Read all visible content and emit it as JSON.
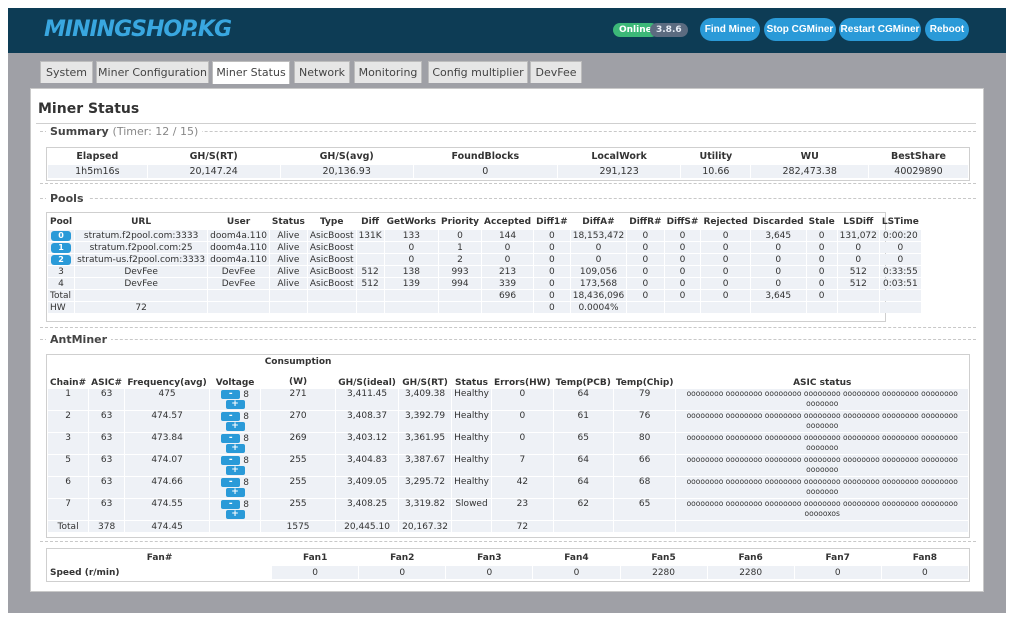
{
  "header": {
    "logo": "MININGSHOP.KG",
    "status": "Online",
    "version": "3.8.6",
    "buttons": [
      "Find Miner",
      "Stop CGMiner",
      "Restart CGMiner",
      "Reboot"
    ]
  },
  "tabs": [
    "System",
    "Miner Configuration",
    "Miner Status",
    "Network",
    "Monitoring",
    "Config multiplier",
    "DevFee"
  ],
  "active_tab": "Miner Status",
  "page_title": "Miner Status",
  "summary": {
    "legend": "Summary",
    "timer": "(Timer: 12 / 15)",
    "headers": [
      "Elapsed",
      "GH/S(RT)",
      "GH/S(avg)",
      "FoundBlocks",
      "LocalWork",
      "Utility",
      "WU",
      "BestShare"
    ],
    "values": [
      "1h5m16s",
      "20,147.24",
      "20,136.93",
      "0",
      "291,123",
      "10.66",
      "282,473.38",
      "40029890"
    ]
  },
  "pools": {
    "legend": "Pools",
    "headers": [
      "Pool",
      "URL",
      "User",
      "Status",
      "Type",
      "Diff",
      "GetWorks",
      "Priority",
      "Accepted",
      "Diff1#",
      "DiffA#",
      "DiffR#",
      "DiffS#",
      "Rejected",
      "Discarded",
      "Stale",
      "LSDiff",
      "LSTime"
    ],
    "rows": [
      [
        "0",
        "stratum.f2pool.com:3333",
        "doom4a.110",
        "Alive",
        "AsicBoost",
        "131K",
        "133",
        "0",
        "144",
        "0",
        "18,153,472",
        "0",
        "0",
        "0",
        "3,645",
        "0",
        "131,072",
        "0:00:20"
      ],
      [
        "1",
        "stratum.f2pool.com:25",
        "doom4a.110",
        "Alive",
        "AsicBoost",
        "",
        "0",
        "1",
        "0",
        "0",
        "0",
        "0",
        "0",
        "0",
        "0",
        "0",
        "0",
        "0"
      ],
      [
        "2",
        "stratum-us.f2pool.com:3333",
        "doom4a.110",
        "Alive",
        "AsicBoost",
        "",
        "0",
        "2",
        "0",
        "0",
        "0",
        "0",
        "0",
        "0",
        "0",
        "0",
        "0",
        "0"
      ],
      [
        "3",
        "DevFee",
        "DevFee",
        "Alive",
        "AsicBoost",
        "512",
        "138",
        "993",
        "213",
        "0",
        "109,056",
        "0",
        "0",
        "0",
        "0",
        "0",
        "512",
        "0:33:55"
      ],
      [
        "4",
        "DevFee",
        "DevFee",
        "Alive",
        "AsicBoost",
        "512",
        "139",
        "994",
        "339",
        "0",
        "173,568",
        "0",
        "0",
        "0",
        "0",
        "0",
        "512",
        "0:03:51"
      ],
      [
        "Total",
        "",
        "",
        "",
        "",
        "",
        "",
        "",
        "696",
        "0",
        "18,436,096",
        "0",
        "0",
        "0",
        "3,645",
        "0",
        "",
        ""
      ],
      [
        "HW",
        "72",
        "",
        "",
        "",
        "",
        "",
        "",
        "",
        "0",
        "0.0004%",
        "",
        "",
        "",
        "",
        "",
        "",
        ""
      ]
    ]
  },
  "antminer": {
    "legend": "AntMiner",
    "headers": [
      "Chain#",
      "ASIC#",
      "Frequency(avg)",
      "Voltage",
      "Consumption (W)",
      "GH/S(ideal)",
      "GH/S(RT)",
      "Status",
      "Errors(HW)",
      "Temp(PCB)",
      "Temp(Chip)",
      "ASIC status"
    ],
    "consumption_top": "Consumption",
    "consumption_bottom": "(W)",
    "minus": "-",
    "plus": "+",
    "rows": [
      {
        "chain": "1",
        "asic": "63",
        "freq": "475",
        "voltage": "8",
        "cons": "271",
        "ideal": "3,411.45",
        "rt": "3,409.38",
        "status": "Healthy",
        "errors": "0",
        "pcb": "64",
        "chip": "79",
        "asic_status": "oooooooo oooooooo oooooooo oooooooo oooooooo oooooooo oooooooo ooooooo"
      },
      {
        "chain": "2",
        "asic": "63",
        "freq": "474.57",
        "voltage": "8",
        "cons": "270",
        "ideal": "3,408.37",
        "rt": "3,392.79",
        "status": "Healthy",
        "errors": "0",
        "pcb": "61",
        "chip": "76",
        "asic_status": "oooooooo oooooooo oooooooo oooooooo oooooooo oooooooo oooooooo ooooooo"
      },
      {
        "chain": "3",
        "asic": "63",
        "freq": "473.84",
        "voltage": "8",
        "cons": "269",
        "ideal": "3,403.12",
        "rt": "3,361.95",
        "status": "Healthy",
        "errors": "0",
        "pcb": "65",
        "chip": "80",
        "asic_status": "oooooooo oooooooo oooooooo oooooooo oooooooo oooooooo oooooooo ooooooo"
      },
      {
        "chain": "5",
        "asic": "63",
        "freq": "474.07",
        "voltage": "8",
        "cons": "255",
        "ideal": "3,404.83",
        "rt": "3,387.67",
        "status": "Healthy",
        "errors": "7",
        "pcb": "64",
        "chip": "66",
        "asic_status": "oooooooo oooooooo oooooooo oooooooo oooooooo oooooooo oooooooo ooooooo"
      },
      {
        "chain": "6",
        "asic": "63",
        "freq": "474.66",
        "voltage": "8",
        "cons": "255",
        "ideal": "3,409.05",
        "rt": "3,295.72",
        "status": "Healthy",
        "errors": "42",
        "pcb": "64",
        "chip": "68",
        "asic_status": "oooooooo oooooooo oooooooo oooooooo oooooooo oooooooo oooooooo ooooooo"
      },
      {
        "chain": "7",
        "asic": "63",
        "freq": "474.55",
        "voltage": "8",
        "cons": "255",
        "ideal": "3,408.25",
        "rt": "3,319.82",
        "status": "Slowed",
        "errors": "23",
        "pcb": "62",
        "chip": "65",
        "asic_status": "oooooooo oooooooo oooooooo oooooooo oooooooo oooooooo oooooooo oooooxos"
      }
    ],
    "total": {
      "label": "Total",
      "asic": "378",
      "freq": "474.45",
      "cons": "1575",
      "ideal": "20,445.10",
      "rt": "20,167.32",
      "errors": "72"
    }
  },
  "fans": {
    "headers": [
      "Fan#",
      "Fan1",
      "Fan2",
      "Fan3",
      "Fan4",
      "Fan5",
      "Fan6",
      "Fan7",
      "Fan8"
    ],
    "row_label": "Speed (r/min)",
    "values": [
      "0",
      "0",
      "0",
      "0",
      "2280",
      "2280",
      "0",
      "0"
    ]
  },
  "colors": {
    "topbar": "#0d3c55",
    "accent": "#2a9ad8",
    "online": "#3cb878",
    "frame": "#9fa0a6",
    "cell": "#eef1f6"
  }
}
